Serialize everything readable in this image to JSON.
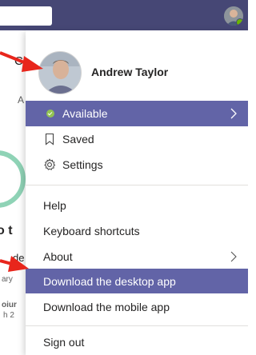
{
  "background": {
    "fragments": [
      "C",
      "A",
      "o t",
      "de",
      "ary",
      "oiur",
      "h 2"
    ]
  },
  "profile": {
    "name": "Andrew Taylor"
  },
  "status": {
    "label": "Available",
    "color": "#92c353"
  },
  "menu": {
    "saved_label": "Saved",
    "settings_label": "Settings",
    "help_label": "Help",
    "shortcuts_label": "Keyboard shortcuts",
    "about_label": "About",
    "download_desktop_label": "Download the desktop app",
    "download_mobile_label": "Download the mobile app",
    "sign_out_label": "Sign out"
  },
  "colors": {
    "topbar": "#464775",
    "accent": "#6264a7",
    "annotation": "#e8261c"
  }
}
